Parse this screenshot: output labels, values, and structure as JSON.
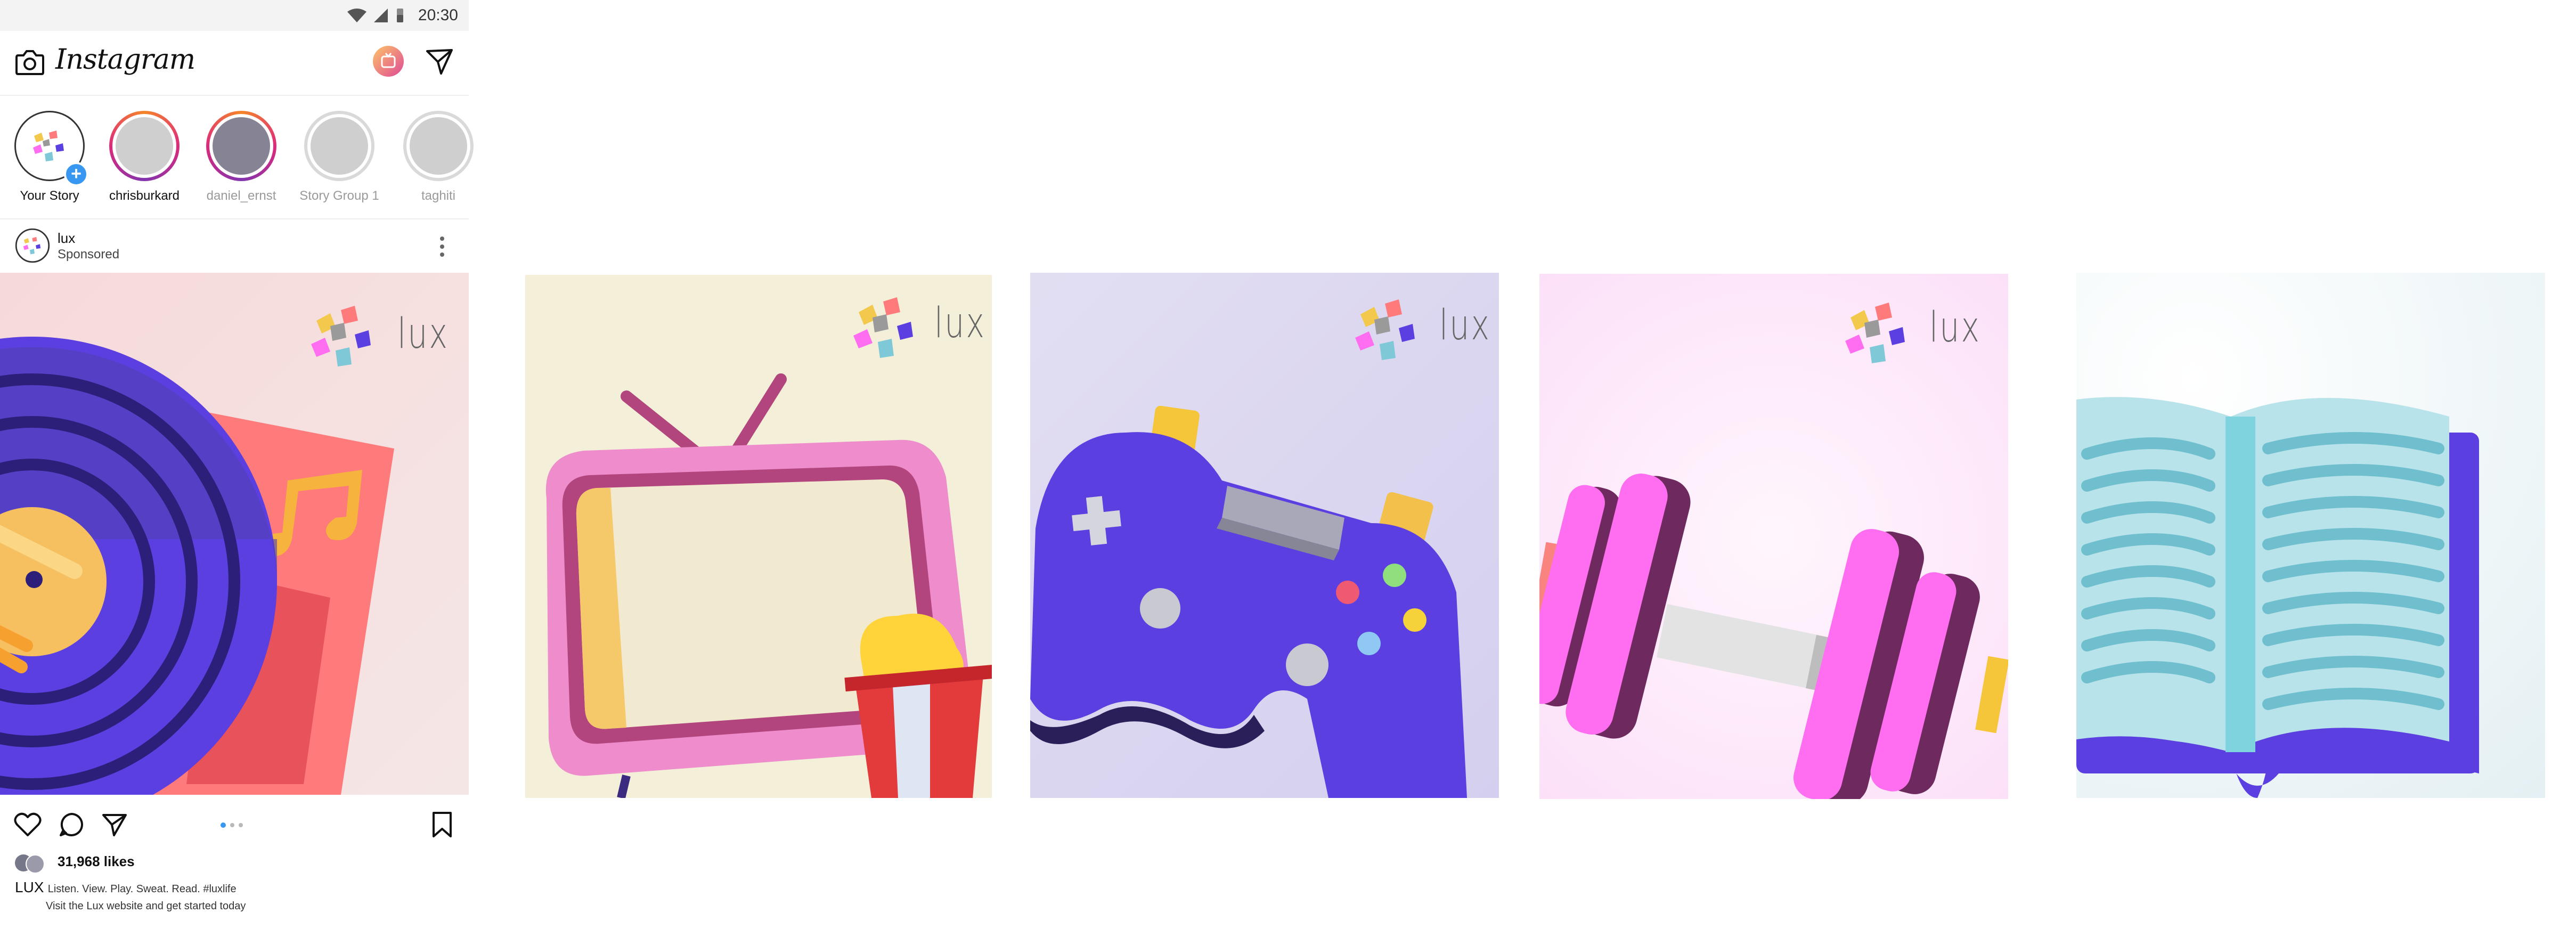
{
  "status": {
    "time": "20:30"
  },
  "header": {
    "app_name": "Instagram"
  },
  "stories": [
    {
      "label": "Your Story",
      "dim": false
    },
    {
      "label": "chrisburkard",
      "dim": false
    },
    {
      "label": "daniel_ernst",
      "dim": true
    },
    {
      "label": "Story Group 1",
      "dim": true
    },
    {
      "label": "taghiti",
      "dim": true
    }
  ],
  "post": {
    "username": "lux",
    "subtitle": "Sponsored",
    "likes": "31,968 likes",
    "caption_user": "LUX",
    "caption_text": "Listen. View. Play. Sweat. Read. #luxlife",
    "caption_line2": "Visit the Lux website and get started today",
    "carousel_index": 1,
    "carousel_count": 3
  },
  "slides": [
    {
      "brand": "lux",
      "theme": "listen",
      "bg": "#f5dada"
    },
    {
      "brand": "lux",
      "theme": "view",
      "bg": "#f3efd9"
    },
    {
      "brand": "lux",
      "theme": "play",
      "bg": "#dcd8ee"
    },
    {
      "brand": "lux",
      "theme": "sweat",
      "bg": "#fde6fa"
    },
    {
      "brand": "",
      "theme": "read",
      "bg": "#eaf3f5"
    }
  ],
  "colors": {
    "accent": "#3897f0",
    "purple": "#5b3fe0",
    "pink": "#ff6ef0"
  }
}
